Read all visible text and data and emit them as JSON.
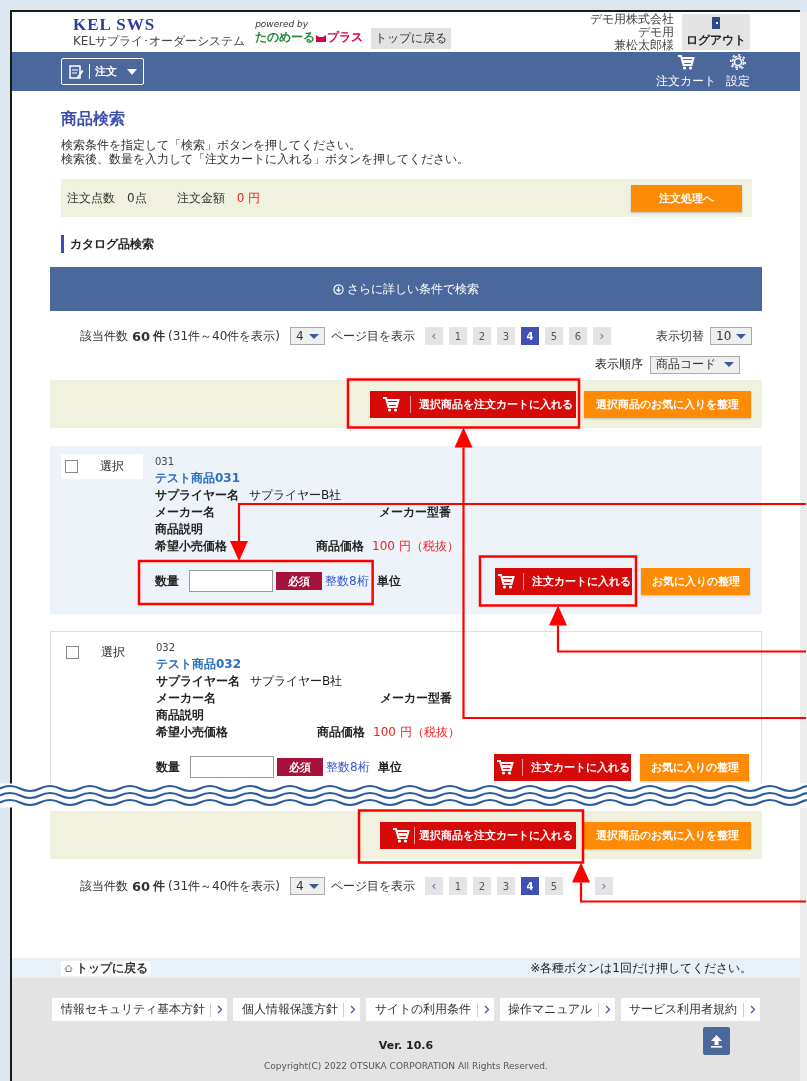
{
  "header": {
    "logo": "KEL SWS",
    "logo_subtitle": "KELサプライ･オーダーシステム",
    "powered_by": "powered by",
    "brand": "たのめーる",
    "brand_suffix": "プラス",
    "top_button": "トップに戻る",
    "user_lines": [
      "デモ用株式会社",
      "デモ用",
      "兼松太郎様"
    ],
    "logout": "ログアウト"
  },
  "nav": {
    "menu": "注文",
    "cart": "注文カート",
    "settings": "設定"
  },
  "page": {
    "title": "商品検索",
    "instructions": [
      "検索条件を指定して「検索」ボタンを押してください。",
      "検索後、数量を入力して「注文カートに入れる」ボタンを押してください。"
    ]
  },
  "summary": {
    "count_label": "注文点数",
    "count": "0点",
    "amount_label": "注文金額",
    "amount": "0 円",
    "proceed": "注文処理へ"
  },
  "section_title": "カタログ品検索",
  "advanced_search": "さらに詳しい条件で検索",
  "pagers": [
    {
      "count_label": "該当件数",
      "count": "60",
      "count_unit": "件",
      "range": "(31件～40件を表示)",
      "page_select": "4",
      "page_label": "ページ目を表示",
      "pages": [
        {
          "kind": "prev",
          "label": "‹",
          "selected": false
        },
        {
          "kind": "page",
          "label": "1",
          "selected": false
        },
        {
          "kind": "page",
          "label": "2",
          "selected": false
        },
        {
          "kind": "page",
          "label": "3",
          "selected": false
        },
        {
          "kind": "page",
          "label": "4",
          "selected": true
        },
        {
          "kind": "page",
          "label": "5",
          "selected": false
        },
        {
          "kind": "page",
          "label": "6",
          "selected": false
        },
        {
          "kind": "next",
          "label": "›",
          "selected": false
        }
      ],
      "per_page_label": "表示切替",
      "per_page": "10",
      "sort_label": "表示順序",
      "sort": "商品コード"
    },
    {
      "count_label": "該当件数",
      "count": "60",
      "count_unit": "件",
      "range": "(31件～40件を表示)",
      "page_select": "4",
      "page_label": "ページ目を表示",
      "pages": [
        {
          "kind": "prev",
          "label": "‹",
          "selected": false
        },
        {
          "kind": "page",
          "label": "1",
          "selected": false
        },
        {
          "kind": "page",
          "label": "2",
          "selected": false
        },
        {
          "kind": "page",
          "label": "3",
          "selected": false
        },
        {
          "kind": "page",
          "label": "4",
          "selected": true
        },
        {
          "kind": "page",
          "label": "5",
          "selected": false
        },
        {
          "kind": "next",
          "label": "›",
          "selected": false
        }
      ]
    }
  ],
  "action_bars": [
    {
      "add_selected": "選択商品を注文カートに入れる",
      "favorite_selected": "選択商品のお気に入りを整理"
    },
    {
      "add_selected": "選択商品を注文カートに入れる",
      "favorite_selected": "選択商品のお気に入りを整理"
    }
  ],
  "products": [
    {
      "highlighted": true,
      "selected": false,
      "select_label": "選択",
      "code": "031",
      "name": "テスト商品031",
      "supplier_label": "サプライヤー名",
      "supplier": "サプライヤーB社",
      "maker_label": "メーカー名",
      "model_label": "メーカー型番",
      "description_label": "商品説明",
      "retail_label": "希望小売価格",
      "price_label": "商品価格",
      "price": "100 円（税抜）",
      "qty_label": "数量",
      "required": "必須",
      "qty_hint": "整数8桁",
      "unit_label": "単位",
      "add_to_cart": "注文カートに入れる",
      "favorite": "お気に入りの整理"
    },
    {
      "highlighted": false,
      "selected": false,
      "select_label": "選択",
      "code": "032",
      "name": "テスト商品032",
      "supplier_label": "サプライヤー名",
      "supplier": "サプライヤーB社",
      "maker_label": "メーカー名",
      "model_label": "メーカー型番",
      "description_label": "商品説明",
      "retail_label": "希望小売価格",
      "price_label": "商品価格",
      "price": "100 円（税抜）",
      "qty_label": "数量",
      "required": "必須",
      "qty_hint": "整数8桁",
      "unit_label": "単位",
      "add_to_cart": "注文カートに入れる",
      "favorite": "お気に入りの整理"
    }
  ],
  "footer": {
    "top_link": "トップに戻る",
    "notice": "※各種ボタンは1回だけ押してください。",
    "links": [
      "情報セキュリティ基本方針",
      "個人情報保護方針",
      "サイトの利用条件",
      "操作マニュアル",
      "サービス利用者規約"
    ],
    "version": "Ver. 10.6",
    "copyright": "Copyright(C) 2022 OTSUKA CORPORATION All Rights Reserved."
  },
  "page_break": {
    "kind": "wave"
  },
  "callouts": [
    {
      "kind": "framed-arrow"
    },
    {
      "kind": "framed-arrow"
    },
    {
      "kind": "framed-arrow"
    },
    {
      "kind": "framed-arrow"
    }
  ]
}
